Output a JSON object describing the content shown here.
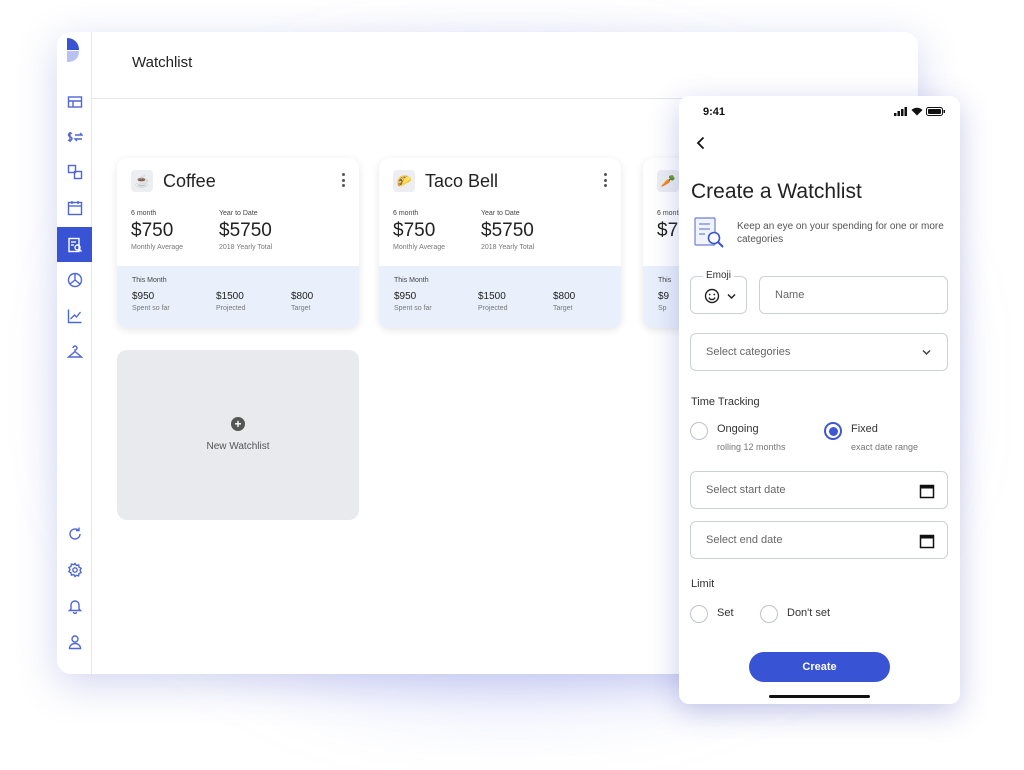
{
  "desktop": {
    "page_title": "Watchlist",
    "cards": [
      {
        "emoji": "☕",
        "name": "Coffee",
        "six_month_label": "6 month",
        "six_month_value": "$750",
        "six_month_sub": "Monthly Average",
        "ytd_label": "Year to Date",
        "ytd_value": "$5750",
        "ytd_sub": "2018 Yearly Total",
        "this_month_label": "This Month",
        "spent_value": "$950",
        "spent_label": "Spent so far",
        "projected_value": "$1500",
        "projected_label": "Projected",
        "target_value": "$800",
        "target_label": "Target"
      },
      {
        "emoji": "🌮",
        "name": "Taco Bell",
        "six_month_label": "6 month",
        "six_month_value": "$750",
        "six_month_sub": "Monthly Average",
        "ytd_label": "Year to Date",
        "ytd_value": "$5750",
        "ytd_sub": "2018 Yearly Total",
        "this_month_label": "This Month",
        "spent_value": "$950",
        "spent_label": "Spent so far",
        "projected_value": "$1500",
        "projected_label": "Projected",
        "target_value": "$800",
        "target_label": "Target"
      },
      {
        "emoji": "🥕",
        "six_month_label": "6 month",
        "six_month_value": "$7",
        "this_month_label": "This",
        "spent_value": "$9",
        "spent_label": "Sp"
      }
    ],
    "new_watchlist_label": "New Watchlist",
    "sidebar_icons": [
      "dashboard-icon",
      "transfer-icon",
      "accounts-icon",
      "calendar-icon",
      "watchlist-icon",
      "pie-chart-icon",
      "trend-icon",
      "hanger-icon",
      "refresh-icon",
      "settings-icon",
      "bell-icon",
      "user-icon"
    ],
    "accent_color": "#3853d3"
  },
  "phone": {
    "status_time": "9:41",
    "title": "Create a Watchlist",
    "intro": "Keep an eye on your spending for one or more categories",
    "emoji_label": "Emoji",
    "name_placeholder": "Name",
    "categories_placeholder": "Select categories",
    "time_tracking_label": "Time Tracking",
    "ongoing_label": "Ongoing",
    "ongoing_sub": "rolling 12 months",
    "fixed_label": "Fixed",
    "fixed_sub": "exact date range",
    "time_tracking_selected": "Fixed",
    "start_date_placeholder": "Select start date",
    "end_date_placeholder": "Select end date",
    "limit_label": "Limit",
    "set_label": "Set",
    "dont_set_label": "Don't set",
    "create_label": "Create"
  }
}
